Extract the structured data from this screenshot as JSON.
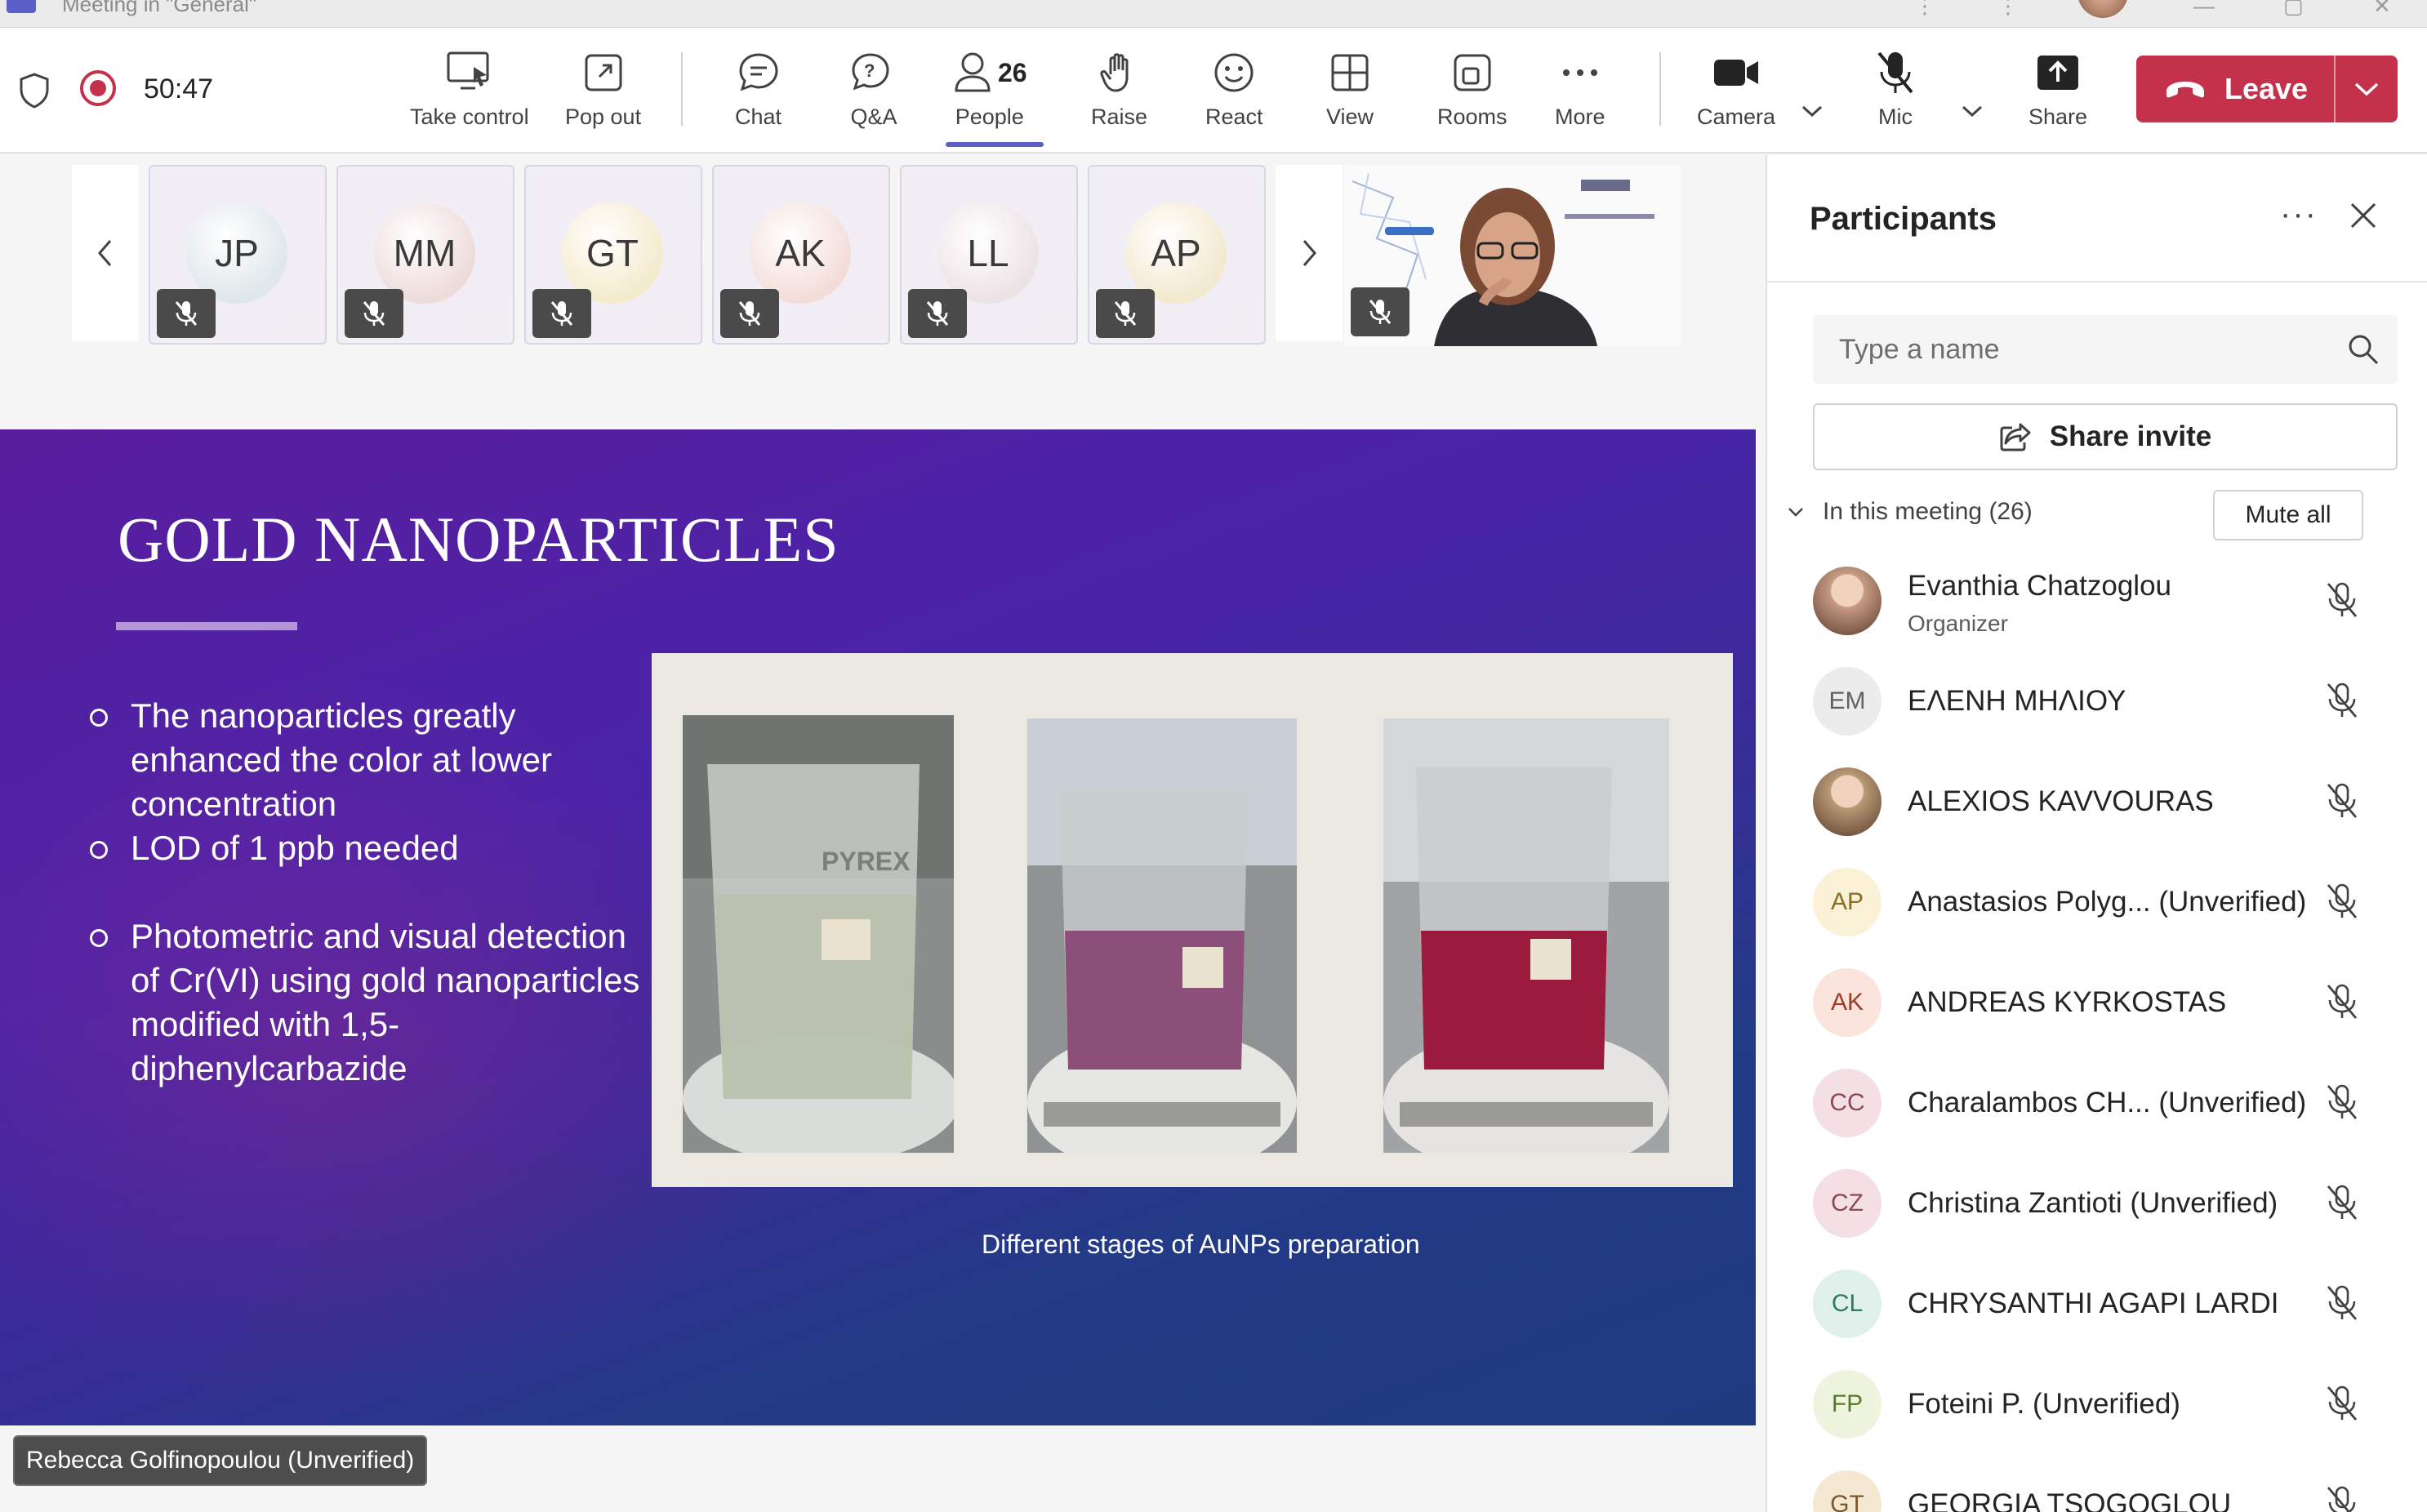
{
  "window": {
    "title": "Meeting in \"General\""
  },
  "toolbar": {
    "timer": "50:47",
    "take_control": "Take control",
    "pop_out": "Pop out",
    "chat": "Chat",
    "qa": "Q&A",
    "people": "People",
    "people_count": "26",
    "raise": "Raise",
    "react": "React",
    "view": "View",
    "rooms": "Rooms",
    "more": "More",
    "camera": "Camera",
    "mic": "Mic",
    "share": "Share",
    "leave": "Leave",
    "accent": "#5b5fc7",
    "leave_color": "#c4314b"
  },
  "strip": {
    "tiles": [
      {
        "initials": "JP",
        "color": "#dfe7ea"
      },
      {
        "initials": "MM",
        "color": "#eddcda"
      },
      {
        "initials": "GT",
        "color": "#f4ebcd"
      },
      {
        "initials": "AK",
        "color": "#f4ddd8"
      },
      {
        "initials": "LL",
        "color": "#ece3e6"
      },
      {
        "initials": "AP",
        "color": "#f3e9cf"
      }
    ]
  },
  "slide": {
    "title": "GOLD NANOPARTICLES",
    "bullets": [
      "The nanoparticles greatly enhanced the color at lower concentration",
      "LOD of 1 ppb needed",
      "Photometric and visual detection of Cr(VI) using gold nanoparticles modified with 1,5-diphenylcarbazide"
    ],
    "caption": "Different stages of AuNPs preparation",
    "beaker_label": "PYREX"
  },
  "presenter_tag": "Rebecca Golfinopoulou (Unverified)",
  "panel": {
    "title": "Participants",
    "search_placeholder": "Type a name",
    "share_invite": "Share invite",
    "section_label": "In this meeting (26)",
    "mute_all": "Mute all",
    "participants": [
      {
        "initials": "",
        "name": "Evanthia Chatzoglou",
        "role": "Organizer",
        "avatar": "photo",
        "color": "#c79b84"
      },
      {
        "initials": "EM",
        "name": "ΕΛΕΝΗ ΜΗΛΙΟΥ",
        "role": "",
        "avatar": "initials",
        "color": "#ececec",
        "text": "#616161"
      },
      {
        "initials": "",
        "name": "ALEXIOS KAVVOURAS",
        "role": "",
        "avatar": "photo",
        "color": "#b89a76"
      },
      {
        "initials": "AP",
        "name": "Anastasios Polyg... (Unverified)",
        "role": "",
        "avatar": "initials",
        "color": "#fbf1d6",
        "text": "#8a6d1f"
      },
      {
        "initials": "AK",
        "name": "ANDREAS KYRKOSTAS",
        "role": "",
        "avatar": "initials",
        "color": "#fbe4dc",
        "text": "#9c3b2a"
      },
      {
        "initials": "CC",
        "name": "Charalambos CH... (Unverified)",
        "role": "",
        "avatar": "initials",
        "color": "#f4e0e4",
        "text": "#8a4a56"
      },
      {
        "initials": "CZ",
        "name": "Christina Zantioti (Unverified)",
        "role": "",
        "avatar": "initials",
        "color": "#f4e0e4",
        "text": "#8a4a56"
      },
      {
        "initials": "CL",
        "name": "CHRYSANTHI AGAPI LARDI",
        "role": "",
        "avatar": "initials",
        "color": "#e0f1ec",
        "text": "#2f7a64"
      },
      {
        "initials": "FP",
        "name": "Foteini P. (Unverified)",
        "role": "",
        "avatar": "initials",
        "color": "#eef5df",
        "text": "#5b7a2b"
      },
      {
        "initials": "GT",
        "name": "GEORGIA TSOGOGLOU",
        "role": "",
        "avatar": "initials",
        "color": "#f4e8d3",
        "text": "#7a5a2b"
      }
    ]
  }
}
